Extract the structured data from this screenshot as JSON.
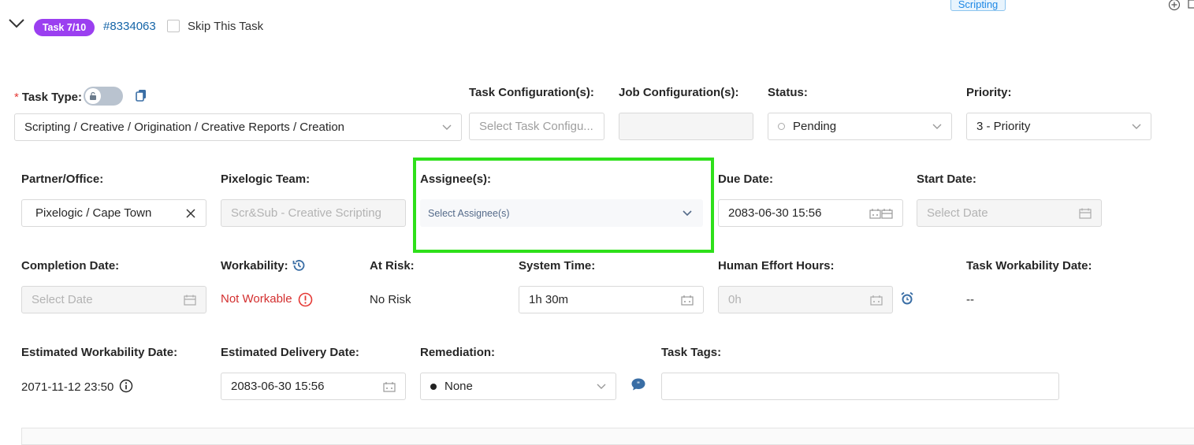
{
  "top_badge": "Scripting",
  "task_header": {
    "badge": "Task 7/10",
    "task_id": "#8334063",
    "skip_label": "Skip This Task"
  },
  "row1": {
    "task_type_label": "Task Type:",
    "task_type_required": "*",
    "task_type_value": "Scripting / Creative / Origination / Creative Reports / Creation",
    "task_config_label": "Task Configuration(s):",
    "task_config_placeholder": "Select Task Configu...",
    "job_config_label": "Job Configuration(s):",
    "status_label": "Status:",
    "status_value": "Pending",
    "priority_label": "Priority:",
    "priority_value": "3 - Priority"
  },
  "row2": {
    "partner_label": "Partner/Office:",
    "partner_value": "Pixelogic / Cape Town",
    "team_label": "Pixelogic Team:",
    "team_value": "Scr&Sub - Creative Scripting",
    "assignee_label": "Assignee(s):",
    "assignee_placeholder": "Select Assignee(s)",
    "due_label": "Due Date:",
    "due_value": "2083-06-30 15:56",
    "start_label": "Start Date:",
    "start_placeholder": "Select Date"
  },
  "row3": {
    "completion_label": "Completion Date:",
    "completion_placeholder": "Select Date",
    "workability_label": "Workability:",
    "workability_value": "Not Workable",
    "at_risk_label": "At Risk:",
    "at_risk_value": "No Risk",
    "system_time_label": "System Time:",
    "system_time_value": "1h 30m",
    "effort_label": "Human Effort Hours:",
    "effort_value": "0h",
    "task_workability_date_label": "Task Workability Date:",
    "task_workability_date_value": "--"
  },
  "row4": {
    "est_workability_label": "Estimated Workability Date:",
    "est_workability_value": "2071-11-12 23:50",
    "est_delivery_label": "Estimated Delivery Date:",
    "est_delivery_value": "2083-06-30 15:56",
    "remediation_label": "Remediation:",
    "remediation_value": "None",
    "task_tags_label": "Task Tags:"
  },
  "colors": {
    "badge_purple": "#9b3ff0",
    "link_blue": "#1565a8",
    "highlight_green": "#2ee01a",
    "error_red": "#d32f2f",
    "icon_blue": "#3a6ea5"
  }
}
